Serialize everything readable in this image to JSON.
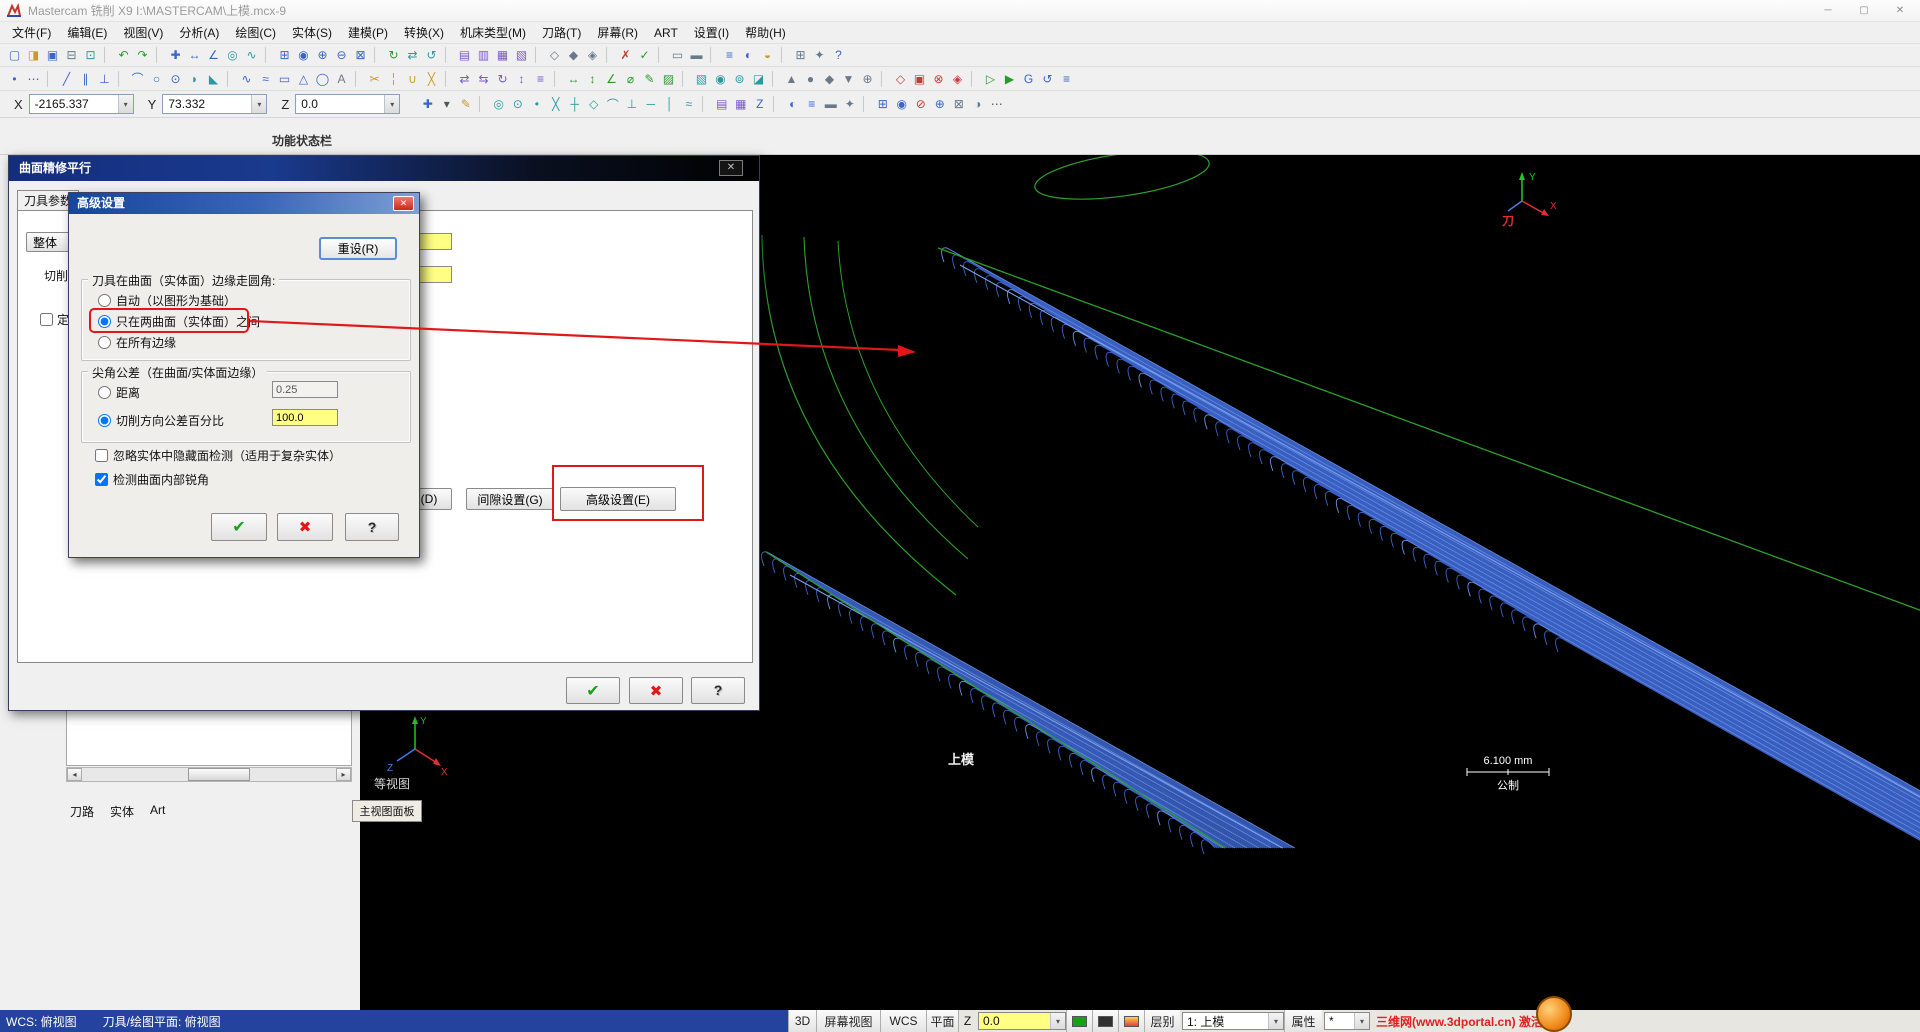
{
  "window": {
    "title": "Mastercam 铣削 X9  I:\\MASTERCAM\\上模.mcx-9",
    "controls": [
      {
        "name": "minimize-button-icon",
        "glyph": "─",
        "color": "#8a8a8a"
      },
      {
        "name": "maximize-button-icon",
        "glyph": "▢",
        "color": "#8a8a8a"
      },
      {
        "name": "close-button-icon",
        "glyph": "✕",
        "color": "#8a8a8a"
      }
    ]
  },
  "menubar": {
    "items": [
      {
        "name": "menu-file",
        "label": "文件(F)"
      },
      {
        "name": "menu-edit",
        "label": "编辑(E)"
      },
      {
        "name": "menu-view",
        "label": "视图(V)"
      },
      {
        "name": "menu-analyze",
        "label": "分析(A)"
      },
      {
        "name": "menu-create",
        "label": "绘图(C)"
      },
      {
        "name": "menu-solids",
        "label": "实体(S)"
      },
      {
        "name": "menu-model-prep",
        "label": "建模(P)"
      },
      {
        "name": "menu-xform",
        "label": "转换(X)"
      },
      {
        "name": "menu-machine-type",
        "label": "机床类型(M)"
      },
      {
        "name": "menu-toolpaths",
        "label": "刀路(T)"
      },
      {
        "name": "menu-screen",
        "label": "屏幕(R)"
      },
      {
        "name": "menu-art",
        "label": "ART"
      },
      {
        "name": "menu-settings",
        "label": "设置(I)"
      },
      {
        "name": "menu-help",
        "label": "帮助(H)"
      }
    ]
  },
  "toolbars": {
    "row1": [
      {
        "name": "new-file-icon",
        "glyph": "▢",
        "color": "#3a66c8"
      },
      {
        "name": "open-file-icon",
        "glyph": "◨",
        "color": "#c89a2a"
      },
      {
        "name": "save-file-icon",
        "glyph": "▣",
        "color": "#3a66c8"
      },
      {
        "name": "print-icon",
        "glyph": "⊟",
        "color": "#6a7a8a"
      },
      {
        "name": "screen-capture-icon",
        "glyph": "⊡",
        "color": "#2a9aa0"
      },
      {
        "sep": true
      },
      {
        "name": "undo-icon",
        "glyph": "↶",
        "color": "#2a9a2a"
      },
      {
        "name": "redo-icon",
        "glyph": "↷",
        "color": "#2a9a2a"
      },
      {
        "sep": true
      },
      {
        "name": "analyze-position-icon",
        "glyph": "✚",
        "color": "#3a66c8"
      },
      {
        "name": "analyze-distance-icon",
        "glyph": "↔",
        "color": "#3a66c8"
      },
      {
        "name": "analyze-angle-icon",
        "glyph": "∠",
        "color": "#3a66c8"
      },
      {
        "name": "analyze-dynamic-icon",
        "glyph": "◎",
        "color": "#2a9aa0"
      },
      {
        "name": "analyze-chain-icon",
        "glyph": "∿",
        "color": "#2a9aa0"
      },
      {
        "sep": true
      },
      {
        "name": "zoom-window-icon",
        "glyph": "⊞",
        "color": "#3a66c8"
      },
      {
        "name": "zoom-target-icon",
        "glyph": "◉",
        "color": "#3a66c8"
      },
      {
        "name": "zoom-in-icon",
        "glyph": "⊕",
        "color": "#3a66c8"
      },
      {
        "name": "zoom-out-icon",
        "glyph": "⊖",
        "color": "#3a66c8"
      },
      {
        "name": "fit-screen-icon",
        "glyph": "⊠",
        "color": "#3a66c8"
      },
      {
        "sep": true
      },
      {
        "name": "repaint-icon",
        "glyph": "↻",
        "color": "#2a9a2a"
      },
      {
        "name": "pan-icon",
        "glyph": "⇄",
        "color": "#2a9aa0"
      },
      {
        "name": "dynamic-rotate-icon",
        "glyph": "↺",
        "color": "#2a9aa0"
      },
      {
        "sep": true
      },
      {
        "name": "gview-top-icon",
        "glyph": "▤",
        "color": "#7a5ac8"
      },
      {
        "name": "gview-front-icon",
        "glyph": "▥",
        "color": "#7a5ac8"
      },
      {
        "name": "gview-side-icon",
        "glyph": "▦",
        "color": "#7a5ac8"
      },
      {
        "name": "gview-isometric-icon",
        "glyph": "▧",
        "color": "#7a5ac8"
      },
      {
        "sep": true
      },
      {
        "name": "wireframe-display-icon",
        "glyph": "◇",
        "color": "#6a7a8a"
      },
      {
        "name": "shaded-display-icon",
        "glyph": "◆",
        "color": "#6a7a8a"
      },
      {
        "name": "translucent-display-icon",
        "glyph": "◈",
        "color": "#6a7a8a"
      },
      {
        "sep": true
      },
      {
        "name": "delete-entity-icon",
        "glyph": "✗",
        "color": "#c83a3a"
      },
      {
        "name": "undelete-icon",
        "glyph": "✓",
        "color": "#2a9a2a"
      },
      {
        "sep": true
      },
      {
        "name": "blank-entity-icon",
        "glyph": "▭",
        "color": "#6a7a8a"
      },
      {
        "name": "unblank-entity-icon",
        "glyph": "▬",
        "color": "#6a7a8a"
      },
      {
        "sep": true
      },
      {
        "name": "levels-icon",
        "glyph": "≡",
        "color": "#3a66c8"
      },
      {
        "name": "attributes-icon",
        "glyph": "◐",
        "color": "#3a66c8"
      },
      {
        "name": "color-icon",
        "glyph": "◒",
        "color": "#c89a2a"
      },
      {
        "sep": true
      },
      {
        "name": "grid-settings-icon",
        "glyph": "⊞",
        "color": "#6a7a8a"
      },
      {
        "name": "config-icon",
        "glyph": "✦",
        "color": "#6a7a8a"
      },
      {
        "name": "help-icon",
        "glyph": "?",
        "color": "#3a66c8"
      }
    ],
    "row2": [
      {
        "name": "point-create-icon",
        "glyph": "•",
        "color": "#3a66c8"
      },
      {
        "name": "point-dynamic-icon",
        "glyph": "⋯",
        "color": "#3a66c8"
      },
      {
        "sep": true
      },
      {
        "name": "line-endpoints-icon",
        "glyph": "╱",
        "color": "#3a66c8"
      },
      {
        "name": "line-parallel-icon",
        "glyph": "∥",
        "color": "#3a66c8"
      },
      {
        "name": "line-perpendicular-icon",
        "glyph": "⊥",
        "color": "#3a66c8"
      },
      {
        "sep": true
      },
      {
        "name": "arc-3point-icon",
        "glyph": "⌒",
        "color": "#3a66c8"
      },
      {
        "name": "circle-center-icon",
        "glyph": "○",
        "color": "#3a66c8"
      },
      {
        "name": "circle-edge-icon",
        "glyph": "⊙",
        "color": "#3a66c8"
      },
      {
        "name": "fillet-icon",
        "glyph": "◗",
        "color": "#2a9aa0"
      },
      {
        "name": "chamfer-icon",
        "glyph": "◣",
        "color": "#2a9aa0"
      },
      {
        "sep": true
      },
      {
        "name": "spline-icon",
        "glyph": "∿",
        "color": "#3a66c8"
      },
      {
        "name": "curve-icon",
        "glyph": "≈",
        "color": "#3a66c8"
      },
      {
        "name": "rectangle-icon",
        "glyph": "▭",
        "color": "#3a66c8"
      },
      {
        "name": "polygon-icon",
        "glyph": "△",
        "color": "#3a66c8"
      },
      {
        "name": "ellipse-icon",
        "glyph": "◯",
        "color": "#3a66c8"
      },
      {
        "name": "letters-icon",
        "glyph": "A",
        "color": "#6a7a8a"
      },
      {
        "sep": true
      },
      {
        "name": "trim-icon",
        "glyph": "✂",
        "color": "#c89a2a"
      },
      {
        "name": "divide-icon",
        "glyph": "╎",
        "color": "#c89a2a"
      },
      {
        "name": "join-icon",
        "glyph": "∪",
        "color": "#c89a2a"
      },
      {
        "name": "break-icon",
        "glyph": "╳",
        "color": "#c89a2a"
      },
      {
        "sep": true
      },
      {
        "name": "xform-translate-icon",
        "glyph": "⇄",
        "color": "#7a5ac8"
      },
      {
        "name": "xform-mirror-icon",
        "glyph": "⇆",
        "color": "#7a5ac8"
      },
      {
        "name": "xform-rotate-icon",
        "glyph": "↻",
        "color": "#7a5ac8"
      },
      {
        "name": "xform-scale-icon",
        "glyph": "↕",
        "color": "#7a5ac8"
      },
      {
        "name": "xform-offset-icon",
        "glyph": "≡",
        "color": "#7a5ac8"
      },
      {
        "sep": true
      },
      {
        "name": "dim-horizontal-icon",
        "glyph": "↔",
        "color": "#2a9a2a"
      },
      {
        "name": "dim-vertical-icon",
        "glyph": "↕",
        "color": "#2a9a2a"
      },
      {
        "name": "dim-angular-icon",
        "glyph": "∠",
        "color": "#2a9a2a"
      },
      {
        "name": "dim-diameter-icon",
        "glyph": "⌀",
        "color": "#2a9a2a"
      },
      {
        "name": "note-icon",
        "glyph": "✎",
        "color": "#2a9a2a"
      },
      {
        "name": "hatch-icon",
        "glyph": "▨",
        "color": "#2a9a2a"
      },
      {
        "sep": true
      },
      {
        "name": "surface-net-icon",
        "glyph": "▧",
        "color": "#2a9aa0"
      },
      {
        "name": "surface-revolve-icon",
        "glyph": "◉",
        "color": "#2a9aa0"
      },
      {
        "name": "surface-offset-icon",
        "glyph": "⊚",
        "color": "#2a9aa0"
      },
      {
        "name": "surface-trim-icon",
        "glyph": "◪",
        "color": "#2a9aa0"
      },
      {
        "sep": true
      },
      {
        "name": "solid-extrude-icon",
        "glyph": "▲",
        "color": "#6a7a8a"
      },
      {
        "name": "solid-revolve-icon",
        "glyph": "●",
        "color": "#6a7a8a"
      },
      {
        "name": "solid-sweep-icon",
        "glyph": "◆",
        "color": "#6a7a8a"
      },
      {
        "name": "solid-loft-icon",
        "glyph": "▼",
        "color": "#6a7a8a"
      },
      {
        "name": "solid-boolean-icon",
        "glyph": "⊕",
        "color": "#6a7a8a"
      },
      {
        "sep": true
      },
      {
        "name": "toolpath-contour-icon",
        "glyph": "◇",
        "color": "#c83a3a"
      },
      {
        "name": "toolpath-pocket-icon",
        "glyph": "▣",
        "color": "#c83a3a"
      },
      {
        "name": "toolpath-drill-icon",
        "glyph": "⊗",
        "color": "#c83a3a"
      },
      {
        "name": "toolpath-surface-icon",
        "glyph": "◈",
        "color": "#c83a3a"
      },
      {
        "sep": true
      },
      {
        "name": "backplot-icon",
        "glyph": "▷",
        "color": "#2a9a2a"
      },
      {
        "name": "verify-icon",
        "glyph": "▶",
        "color": "#2a9a2a"
      },
      {
        "name": "post-icon",
        "glyph": "G",
        "color": "#3a66c8"
      },
      {
        "name": "regen-icon",
        "glyph": "↺",
        "color": "#3a66c8"
      },
      {
        "name": "operations-manager-icon",
        "glyph": "≡",
        "color": "#3a66c8"
      }
    ],
    "coord_icons": [
      {
        "name": "autocursor-icon",
        "glyph": "✚",
        "color": "#3a66c8"
      },
      {
        "name": "autocursor-dropdown-icon",
        "glyph": "▾",
        "color": "#555555"
      },
      {
        "name": "fastpoint-icon",
        "glyph": "✎",
        "color": "#c89a2a"
      },
      {
        "sep": true
      },
      {
        "name": "origin-snap-icon",
        "glyph": "◎",
        "color": "#2a9aa0"
      },
      {
        "name": "center-snap-icon",
        "glyph": "⊙",
        "color": "#2a9aa0"
      },
      {
        "name": "endpoint-snap-icon",
        "glyph": "•",
        "color": "#2a9aa0"
      },
      {
        "name": "intersection-snap-icon",
        "glyph": "╳",
        "color": "#2a9aa0"
      },
      {
        "name": "midpoint-snap-icon",
        "glyph": "┼",
        "color": "#2a9aa0"
      },
      {
        "name": "quadrant-snap-icon",
        "glyph": "◇",
        "color": "#2a9aa0"
      },
      {
        "name": "tangent-snap-icon",
        "glyph": "⌒",
        "color": "#2a9aa0"
      },
      {
        "name": "perpendicular-snap-icon",
        "glyph": "⊥",
        "color": "#2a9aa0"
      },
      {
        "name": "horizontal-snap-icon",
        "glyph": "─",
        "color": "#2a9aa0"
      },
      {
        "name": "vertical-snap-icon",
        "glyph": "│",
        "color": "#2a9aa0"
      },
      {
        "name": "nearest-snap-icon",
        "glyph": "≈",
        "color": "#2a9aa0"
      },
      {
        "sep": true
      },
      {
        "name": "gview-menu-icon",
        "glyph": "▤",
        "color": "#7a5ac8"
      },
      {
        "name": "planes-menu-icon",
        "glyph": "▦",
        "color": "#7a5ac8"
      },
      {
        "name": "zdepth-icon",
        "glyph": "Z",
        "color": "#3a66c8"
      },
      {
        "sep": true
      },
      {
        "name": "attributes-menu-icon",
        "glyph": "◐",
        "color": "#3a66c8"
      },
      {
        "name": "level-menu-icon",
        "glyph": "≡",
        "color": "#3a66c8"
      },
      {
        "name": "linestyle-icon",
        "glyph": "▬",
        "color": "#6a7a8a"
      },
      {
        "name": "pointstyle-icon",
        "glyph": "✦",
        "color": "#6a7a8a"
      },
      {
        "sep": true
      },
      {
        "name": "group-icon",
        "glyph": "⊞",
        "color": "#3a66c8"
      },
      {
        "name": "result-icon",
        "glyph": "◉",
        "color": "#3a66c8"
      },
      {
        "name": "disable-icon",
        "glyph": "⊘",
        "color": "#c83a3a"
      },
      {
        "name": "tool-display-icon",
        "glyph": "⊕",
        "color": "#3a66c8"
      },
      {
        "name": "wcs-lock-icon",
        "glyph": "⊠",
        "color": "#6a7a8a"
      },
      {
        "name": "view-sync-icon",
        "glyph": "◑",
        "color": "#6a7a8a"
      },
      {
        "name": "more-options-icon",
        "glyph": "⋯",
        "color": "#555555"
      }
    ]
  },
  "coordbar": {
    "x_label": "X",
    "x_value": "-2165.337",
    "y_label": "Y",
    "y_value": "73.332",
    "z_label": "Z",
    "z_value": "0.0"
  },
  "funcbar": {
    "label": "功能状态栏"
  },
  "viewport": {
    "view_label": "等视图",
    "part_label": "上模",
    "scale_value": "6.100 mm",
    "units": "公制",
    "tool_plane_label": "刀",
    "axis_labels": {
      "x": "X",
      "y": "Y",
      "z": "Z"
    }
  },
  "left_panel": {
    "tabs": [
      {
        "name": "tab-toolpaths",
        "label": "刀路"
      },
      {
        "name": "tab-solids",
        "label": "实体"
      },
      {
        "name": "tab-art",
        "label": "Art"
      }
    ]
  },
  "view_panel_tab": {
    "label": "主视图面板"
  },
  "parent_dialog": {
    "title": "曲面精修平行",
    "close_glyph": "✕",
    "tab_label": "刀具参数",
    "overall_button": "整体",
    "cut_label": "切削",
    "define_label": "定",
    "button_d": "(D)",
    "button_gap": "间隙设置(G)",
    "button_advanced": "高级设置(E)",
    "ok_glyph": "✔",
    "cancel_glyph": "✖",
    "help_glyph": "?"
  },
  "adv_dialog": {
    "title": "高级设置",
    "close_glyph": "✕",
    "reset_button": "重设(R)",
    "group1_title": "刀具在曲面（实体面）边缘走圆角:",
    "radio_auto": "自动（以图形为基础）",
    "radio_between": "只在两曲面（实体面）之间",
    "radio_all": "在所有边缘",
    "group2_title": "尖角公差（在曲面/实体面边缘）",
    "radio_distance": "距离",
    "distance_value": "0.25",
    "radio_percent": "切削方向公差百分比",
    "percent_value": "100.0",
    "check_ignore": "忽略实体中隐藏面检测（适用于复杂实体）",
    "check_detect": "检测曲面内部锐角",
    "ok_glyph": "✔",
    "cancel_glyph": "✖",
    "help_glyph": "?",
    "states": {
      "auto": false,
      "between": true,
      "all_edges": false,
      "distance": false,
      "percent": true,
      "ignore_hidden": false,
      "detect_sharp": true,
      "define": false
    }
  },
  "statusbar": {
    "wcs_text": "WCS: 俯视图",
    "plane_text": "刀具/绘图平面: 俯视图",
    "btn_3d": "3D",
    "btn_screen_view": "屏幕视图",
    "btn_wcs": "WCS",
    "btn_plane": "平面",
    "z_label": "Z",
    "z_value": "0.0",
    "level_label": "层别",
    "level_value": "1: 上模",
    "attr_label": "属性",
    "attr_value": "*",
    "watermark": "三维网(www.3dportal.cn) 激活(e)"
  }
}
